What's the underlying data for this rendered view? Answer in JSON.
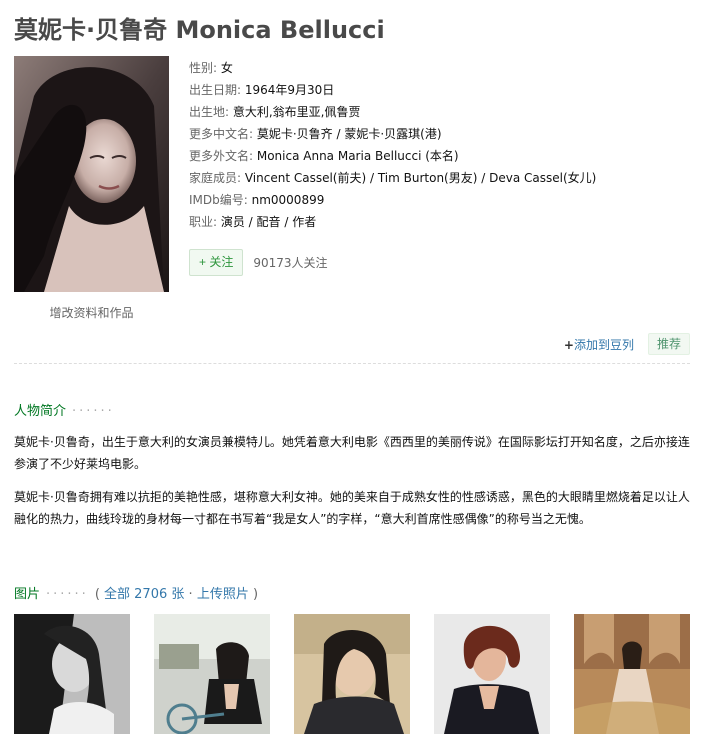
{
  "person": {
    "title": "莫妮卡·贝鲁奇 Monica Bellucci",
    "edit_link": "增改资料和作品"
  },
  "info": [
    {
      "label": "性别: ",
      "value": "女"
    },
    {
      "label": "出生日期: ",
      "value": "1964年9月30日"
    },
    {
      "label": "出生地: ",
      "value": "意大利,翁布里亚,佩鲁贾"
    },
    {
      "label": "更多中文名: ",
      "value": "莫妮卡·贝鲁齐 / 蒙妮卡·贝露琪(港)"
    },
    {
      "label": "更多外文名: ",
      "value": "Monica Anna Maria Bellucci (本名)"
    },
    {
      "label": "家庭成员: ",
      "value": "Vincent Cassel(前夫) / Tim Burton(男友) / Deva Cassel(女儿)"
    },
    {
      "label": "IMDb编号: ",
      "value": "nm0000899"
    },
    {
      "label": "职业: ",
      "value": "演员 / 配音 / 作者"
    }
  ],
  "follow": {
    "button_label": "+ 关注",
    "count_text": "90173人关注"
  },
  "doulist": {
    "plus": "+",
    "add_label": "添加到豆列",
    "recommend_label": "推荐"
  },
  "bio_section": {
    "title": "人物简介",
    "dots": "······",
    "paragraphs": [
      "莫妮卡·贝鲁奇，出生于意大利的女演员兼模特儿。她凭着意大利电影《西西里的美丽传说》在国际影坛打开知名度，之后亦接连参演了不少好莱坞电影。",
      "莫妮卡·贝鲁奇拥有难以抗拒的美艳性感，堪称意大利女神。她的美来自于成熟女性的性感诱惑，黑色的大眼睛里燃烧着足以让人融化的热力，曲线玲珑的身材每一寸都在书写着“我是女人”的字样，“意大利首席性感偶像”的称号当之无愧。"
    ]
  },
  "photo_section": {
    "title": "图片",
    "dots": "······",
    "open_paren": "(",
    "all_link": "全部 2706 张",
    "separator": "·",
    "upload_link": "上传照片",
    "close_paren": ")"
  },
  "photos": [
    {
      "alt": "black-white portrait"
    },
    {
      "alt": "bicycle photo"
    },
    {
      "alt": "dark portrait"
    },
    {
      "alt": "red hair portrait"
    },
    {
      "alt": "outdoor dress photo"
    }
  ]
}
